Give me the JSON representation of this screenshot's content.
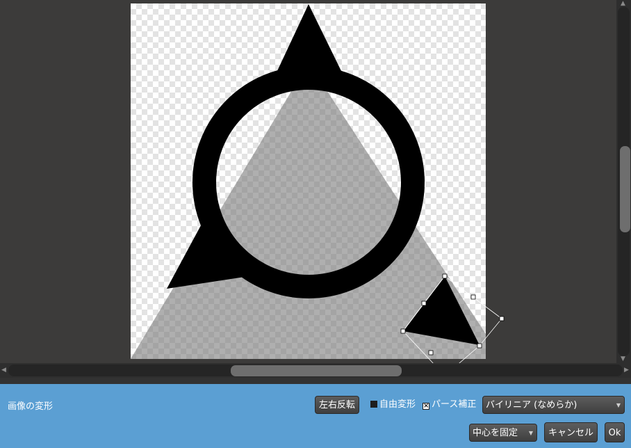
{
  "panel": {
    "title": "画像の変形",
    "flip_button": "左右反転",
    "free_transform": {
      "label": "自由変形",
      "checked": false
    },
    "perspective": {
      "label": "パース補正",
      "checked": true
    },
    "interpolation": {
      "value": "バイリニア (なめらか)"
    },
    "anchor": {
      "value": "中心を固定"
    },
    "cancel_button": "キャンセル",
    "ok_button": "Ok"
  },
  "icons": {
    "scroll_up": "triangle-up-icon",
    "scroll_down": "triangle-down-icon",
    "scroll_left": "triangle-left-icon",
    "scroll_right": "triangle-right-icon",
    "dropdown": "chevron-down-icon",
    "checkbox_checked": "x-mark-icon"
  },
  "colors": {
    "panel_background": "#5b9fd3",
    "workspace_background": "#3c3b3a",
    "shape_fill": "#000000",
    "shadow_fill": "#888888"
  }
}
